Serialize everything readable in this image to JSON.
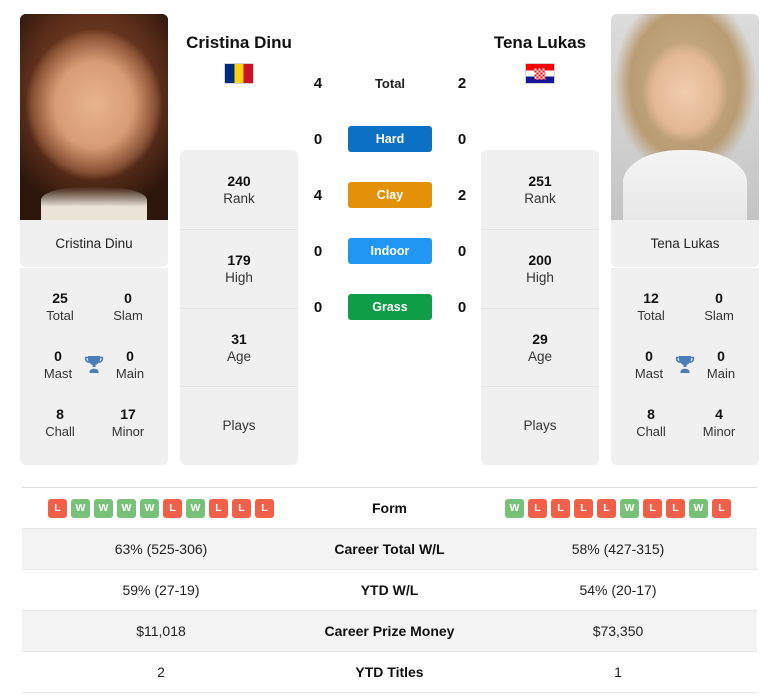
{
  "players": {
    "left": {
      "name": "Cristina Dinu",
      "caption": "Cristina Dinu",
      "country": "Romania",
      "flag_icon": "flag-romania-icon",
      "stats": [
        {
          "value": "240",
          "label": "Rank"
        },
        {
          "value": "179",
          "label": "High"
        },
        {
          "value": "31",
          "label": "Age"
        },
        {
          "value": "",
          "label": "Plays"
        }
      ],
      "titles": [
        {
          "left_value": "25",
          "left_label": "Total",
          "right_value": "0",
          "right_label": "Slam"
        },
        {
          "left_value": "0",
          "left_label": "Mast",
          "right_value": "0",
          "right_label": "Main"
        },
        {
          "left_value": "8",
          "left_label": "Chall",
          "right_value": "17",
          "right_label": "Minor"
        }
      ],
      "form": [
        "L",
        "W",
        "W",
        "W",
        "W",
        "L",
        "W",
        "L",
        "L",
        "L"
      ],
      "career_total_wl": "63% (525-306)",
      "ytd_wl": "59% (27-19)",
      "career_prize_money": "$11,018",
      "ytd_titles": "2"
    },
    "right": {
      "name": "Tena Lukas",
      "caption": "Tena Lukas",
      "country": "Croatia",
      "flag_icon": "flag-croatia-icon",
      "stats": [
        {
          "value": "251",
          "label": "Rank"
        },
        {
          "value": "200",
          "label": "High"
        },
        {
          "value": "29",
          "label": "Age"
        },
        {
          "value": "",
          "label": "Plays"
        }
      ],
      "titles": [
        {
          "left_value": "12",
          "left_label": "Total",
          "right_value": "0",
          "right_label": "Slam"
        },
        {
          "left_value": "0",
          "left_label": "Mast",
          "right_value": "0",
          "right_label": "Main"
        },
        {
          "left_value": "8",
          "left_label": "Chall",
          "right_value": "4",
          "right_label": "Minor"
        }
      ],
      "form": [
        "W",
        "L",
        "L",
        "L",
        "L",
        "W",
        "L",
        "L",
        "W",
        "L"
      ],
      "career_total_wl": "58% (427-315)",
      "ytd_wl": "54% (20-17)",
      "career_prize_money": "$73,350",
      "ytd_titles": "1"
    }
  },
  "head_to_head": {
    "total": {
      "label": "Total",
      "left": "4",
      "right": "2"
    },
    "surfaces": [
      {
        "label": "Hard",
        "left": "0",
        "right": "0",
        "color": "#0c70c4"
      },
      {
        "label": "Clay",
        "left": "4",
        "right": "2",
        "color": "#e39208"
      },
      {
        "label": "Indoor",
        "left": "0",
        "right": "0",
        "color": "#2196f3"
      },
      {
        "label": "Grass",
        "left": "0",
        "right": "0",
        "color": "#0f9d47"
      }
    ]
  },
  "table": {
    "rows": [
      {
        "label": "Form"
      },
      {
        "label": "Career Total W/L"
      },
      {
        "label": "YTD W/L"
      },
      {
        "label": "Career Prize Money"
      },
      {
        "label": "YTD Titles"
      }
    ]
  },
  "colors": {
    "win": "#77c178",
    "loss": "#f1614a",
    "card_bg": "#f0f0f0",
    "alt_row": "#f3f3f3"
  }
}
